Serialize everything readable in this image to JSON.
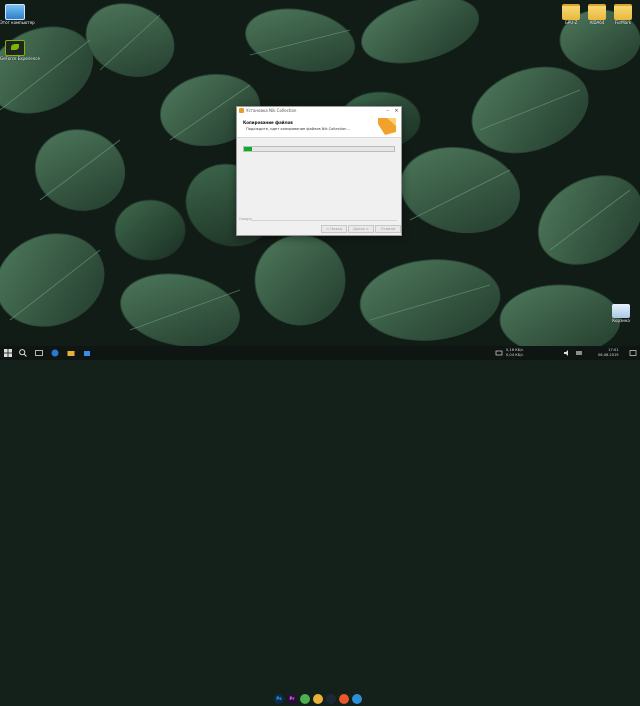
{
  "desktop": {
    "icons_left": [
      {
        "name": "this-pc",
        "label": "Этот компьютер",
        "icon": "pc-icon"
      },
      {
        "name": "geforce-experience",
        "label": "GeForce Experience",
        "icon": "nvidia-icon"
      }
    ],
    "icons_top_right": [
      {
        "name": "gpu-z",
        "label": "GPU-Z",
        "icon": "folder-icon"
      },
      {
        "name": "aida64",
        "label": "AIDA64",
        "icon": "folder-icon"
      },
      {
        "name": "furmark",
        "label": "FurMark",
        "icon": "folder-icon"
      }
    ],
    "recycle_bin": {
      "label": "Корзина",
      "icon": "recycle-bin-icon"
    }
  },
  "dialog": {
    "title": "Установка Nik Collection",
    "header_title": "Копирование файлов",
    "header_subtitle": "Подождите, идет копирование файлов Nik Collection...",
    "progress_percent": 5,
    "brand": "Google",
    "buttons": {
      "back": "< Назад",
      "next": "Далее >",
      "cancel": "Отмена"
    },
    "accent_color": "#f0a22d",
    "progress_color": "#06b025"
  },
  "taskbar": {
    "apps": [
      {
        "name": "photoshop",
        "label": "Ps",
        "color": "#0b2c4a",
        "text_color": "#31a8ff"
      },
      {
        "name": "premiere",
        "label": "Pr",
        "color": "#2a0d3a",
        "text_color": "#ea77ff"
      },
      {
        "name": "chrome",
        "label": "",
        "color": "#4caf50",
        "text_color": "#fff"
      },
      {
        "name": "explorer",
        "label": "",
        "color": "#e8b23a",
        "text_color": "#fff"
      },
      {
        "name": "steam",
        "label": "",
        "color": "#1b2838",
        "text_color": "#fff"
      },
      {
        "name": "media-player",
        "label": "",
        "color": "#e9572b",
        "text_color": "#fff"
      },
      {
        "name": "messenger",
        "label": "",
        "color": "#2e8fd6",
        "text_color": "#fff"
      }
    ],
    "tray_left": {
      "line1": "0,16 КБ/с",
      "line2": "0,04 КБ/с"
    },
    "tray_right": {
      "line1": "17:01",
      "line2": "06.06.2019"
    }
  }
}
